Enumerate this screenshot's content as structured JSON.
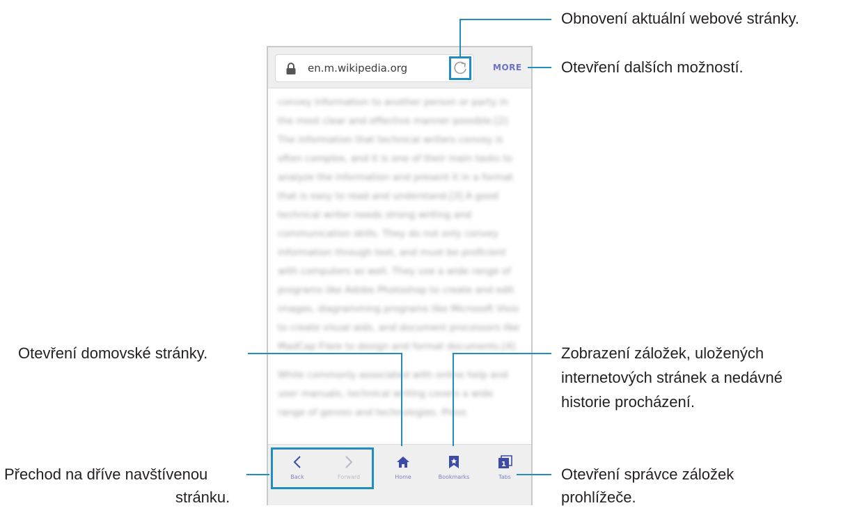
{
  "browser": {
    "url": "en.m.wikipedia.org",
    "more_label": "MORE",
    "content_paragraphs": [
      "convey information to another person or party in the most clear and effective manner possible.[2] The information that technical writers convey is often complex, and it is one of their main tasks to analyze the information and present it in a format that is easy to read and understand.[3] A good technical writer needs strong writing and communication skills. They do not only convey information through text, and must be proficient with computers as well. They use a wide range of programs like Adobe Photoshop to create and edit images, diagramming programs like Microsoft Visio to create visual aids, and document processors like MadCap Flare to design and format documents.[4]",
      "While commonly associated with online help and user manuals, technical writing covers a wide range of genres and technologies. Press"
    ],
    "nav": {
      "back": "Back",
      "forward": "Forward",
      "home": "Home",
      "bookmarks": "Bookmarks",
      "tabs": "Tabs",
      "tabs_count": "1"
    }
  },
  "callouts": {
    "refresh": "Obnovení aktuální webové stránky.",
    "more": "Otevření dalších možností.",
    "home": "Otevření domovské stránky.",
    "bookmarks_line1": "Zobrazení záložek, uložených",
    "bookmarks_line2": "internetových stránek a nedávné",
    "bookmarks_line3": "historie procházení.",
    "back_line1": "Přechod na dříve navštívenou",
    "back_line2": "stránku.",
    "tabs_line1": "Otevření správce záložek",
    "tabs_line2": "prohlížeče."
  },
  "colors": {
    "accent": "#1f8dbf",
    "more_text": "#6b72c8",
    "nav_icon": "#3d4aa6"
  }
}
